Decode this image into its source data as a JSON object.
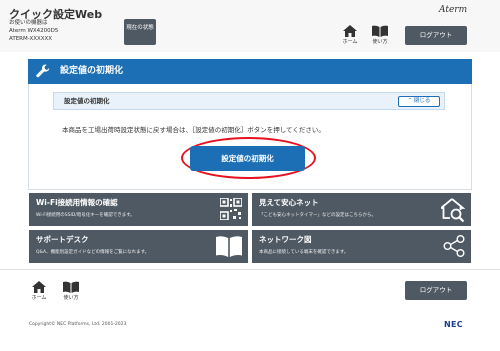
{
  "header": {
    "app_title": "クイック設定Web",
    "device_label": "お使いの機器は",
    "device_model": "Aterm WX4200D5",
    "device_id": "ATERM-XXXXXX",
    "status_button": "現在の状態",
    "logo": "Aterm",
    "home_label": "ホーム",
    "help_label": "使い方",
    "logout_label": "ログアウト"
  },
  "main": {
    "section_title": "設定値の初期化",
    "sub_title": "設定値の初期化",
    "close_label": "閉じる",
    "description": "本商品を工場出荷時設定状態に戻す場合は、［設定値の初期化］ボタンを押してください。",
    "init_button": "設定値の初期化"
  },
  "tiles": [
    {
      "title": "Wi-Fi接続用情報の確認",
      "desc": "Wi-Fi接続用のSSID/暗号化キーを確認できます。",
      "icon": "qr-code-icon"
    },
    {
      "title": "見えて安心ネット",
      "desc": "「こども安心ネットタイマー」などの設定はこちらから。",
      "icon": "house-search-icon"
    },
    {
      "title": "サポートデスク",
      "desc": "Q&A、機能別設定ガイドなどの情報をご覧になれます。",
      "icon": "book-icon"
    },
    {
      "title": "ネットワーク図",
      "desc": "本商品に接続している端末を確認できます。",
      "icon": "share-network-icon"
    }
  ],
  "footer": {
    "home_label": "ホーム",
    "help_label": "使い方",
    "logout_label": "ログアウト",
    "copyright": "Copyright© NEC Platforms, Ltd. 2001-2023",
    "brand": "NEC"
  },
  "colors": {
    "accent": "#1c6fb5",
    "tile": "#4f5963",
    "highlight": "#e4131f"
  }
}
